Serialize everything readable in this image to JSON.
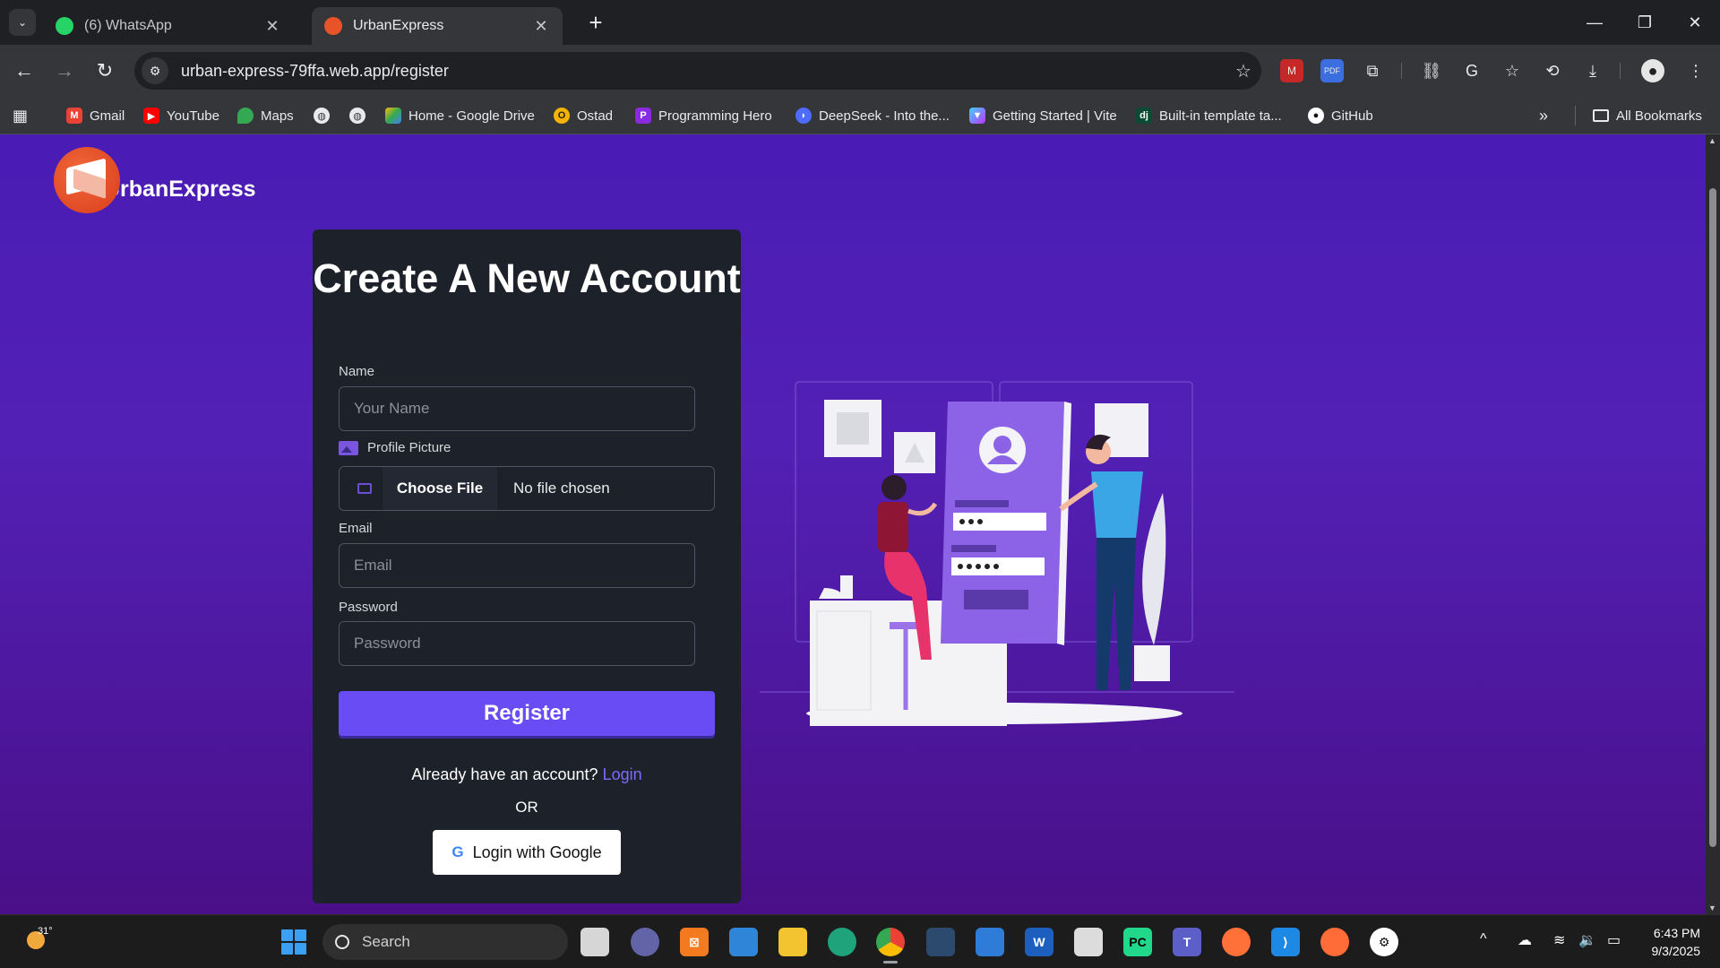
{
  "browser": {
    "tabs": [
      {
        "title": "(6) WhatsApp",
        "active": false,
        "favicon_color": "#25d366",
        "icon": "whatsapp-icon"
      },
      {
        "title": "UrbanExpress",
        "active": true,
        "favicon_color": "#e8532a",
        "icon": "urbanexpress-icon"
      }
    ],
    "url": "urban-express-79ffa.web.app/register",
    "bookmarks": [
      {
        "label": "Gmail",
        "icon": "gmail-icon",
        "color": "#ea4335"
      },
      {
        "label": "YouTube",
        "icon": "youtube-icon",
        "color": "#ff0000"
      },
      {
        "label": "Maps",
        "icon": "maps-icon",
        "color": "#34a853"
      },
      {
        "label": "",
        "icon": "globe-icon",
        "color": "#5f6368"
      },
      {
        "label": "",
        "icon": "globe-icon",
        "color": "#5f6368"
      },
      {
        "label": "Home - Google Drive",
        "icon": "google-drive-icon",
        "color": "#fbbc04"
      },
      {
        "label": "Ostad",
        "icon": "ostad-icon",
        "color": "#f5b301"
      },
      {
        "label": "Programming Hero",
        "icon": "programming-hero-icon",
        "color": "#8a2be2"
      },
      {
        "label": "DeepSeek - Into the...",
        "icon": "deepseek-icon",
        "color": "#4d6bfe"
      },
      {
        "label": "Getting Started | Vite",
        "icon": "vite-icon",
        "color": "#a259ff"
      },
      {
        "label": "Built-in template ta...",
        "icon": "django-icon",
        "color": "#0c4b33"
      },
      {
        "label": "GitHub",
        "icon": "github-icon",
        "color": "#ffffff"
      }
    ],
    "all_bookmarks": "All Bookmarks"
  },
  "page": {
    "brand": "UrbanExpress",
    "heading": "Create A New Account",
    "name_label": "Name",
    "name_placeholder": "Your Name",
    "profile_label": "Profile Picture",
    "choose_file": "Choose File",
    "no_file": "No file chosen",
    "email_label": "Email",
    "email_placeholder": "Email",
    "password_label": "Password",
    "password_placeholder": "Password",
    "register": "Register",
    "already": "Already have an account?",
    "login": "Login",
    "or": "OR",
    "google": "Login with Google",
    "colors": {
      "background": "#4f1cb0",
      "card": "#1d2129",
      "accent": "#6a4cf5"
    }
  },
  "taskbar": {
    "temperature": "31°",
    "search": "Search",
    "time": "6:43 PM",
    "date": "9/3/2025"
  }
}
